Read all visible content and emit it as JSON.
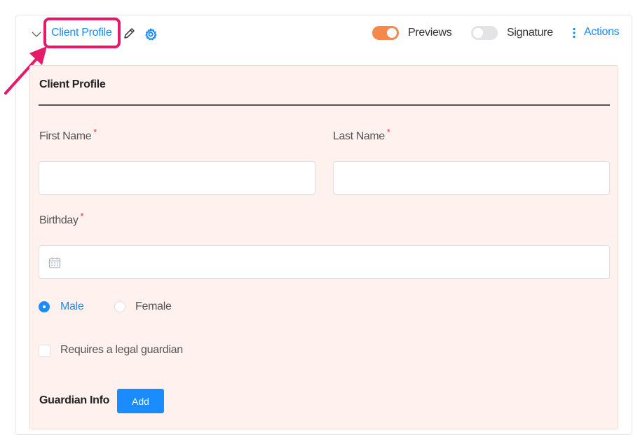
{
  "header": {
    "title": "Client Profile",
    "toggles": [
      {
        "label": "Previews",
        "on": true
      },
      {
        "label": "Signature",
        "on": false
      }
    ],
    "actions_label": "Actions"
  },
  "form": {
    "section_title": "Client Profile",
    "first_name": {
      "label": "First Name",
      "required_mark": "*",
      "value": ""
    },
    "last_name": {
      "label": "Last Name",
      "required_mark": "*",
      "value": ""
    },
    "birthday": {
      "label": "Birthday",
      "required_mark": "*",
      "value": ""
    },
    "gender_options": [
      {
        "label": "Male",
        "selected": true
      },
      {
        "label": "Female",
        "selected": false
      }
    ],
    "legal_guardian": {
      "label": "Requires a legal guardian",
      "checked": false
    },
    "guardian_info": {
      "label": "Guardian Info",
      "add_button": "Add"
    }
  },
  "colors": {
    "accent": "#1a8cff",
    "toggle_on": "#f5884a",
    "highlight": "#e6196b",
    "panel_bg": "#fff1ee",
    "required": "#e53935"
  },
  "icons": [
    "chevron-down-icon",
    "pencil-icon",
    "gear-icon",
    "more-vertical-icon",
    "calendar-icon",
    "arrow-annotation-icon"
  ]
}
